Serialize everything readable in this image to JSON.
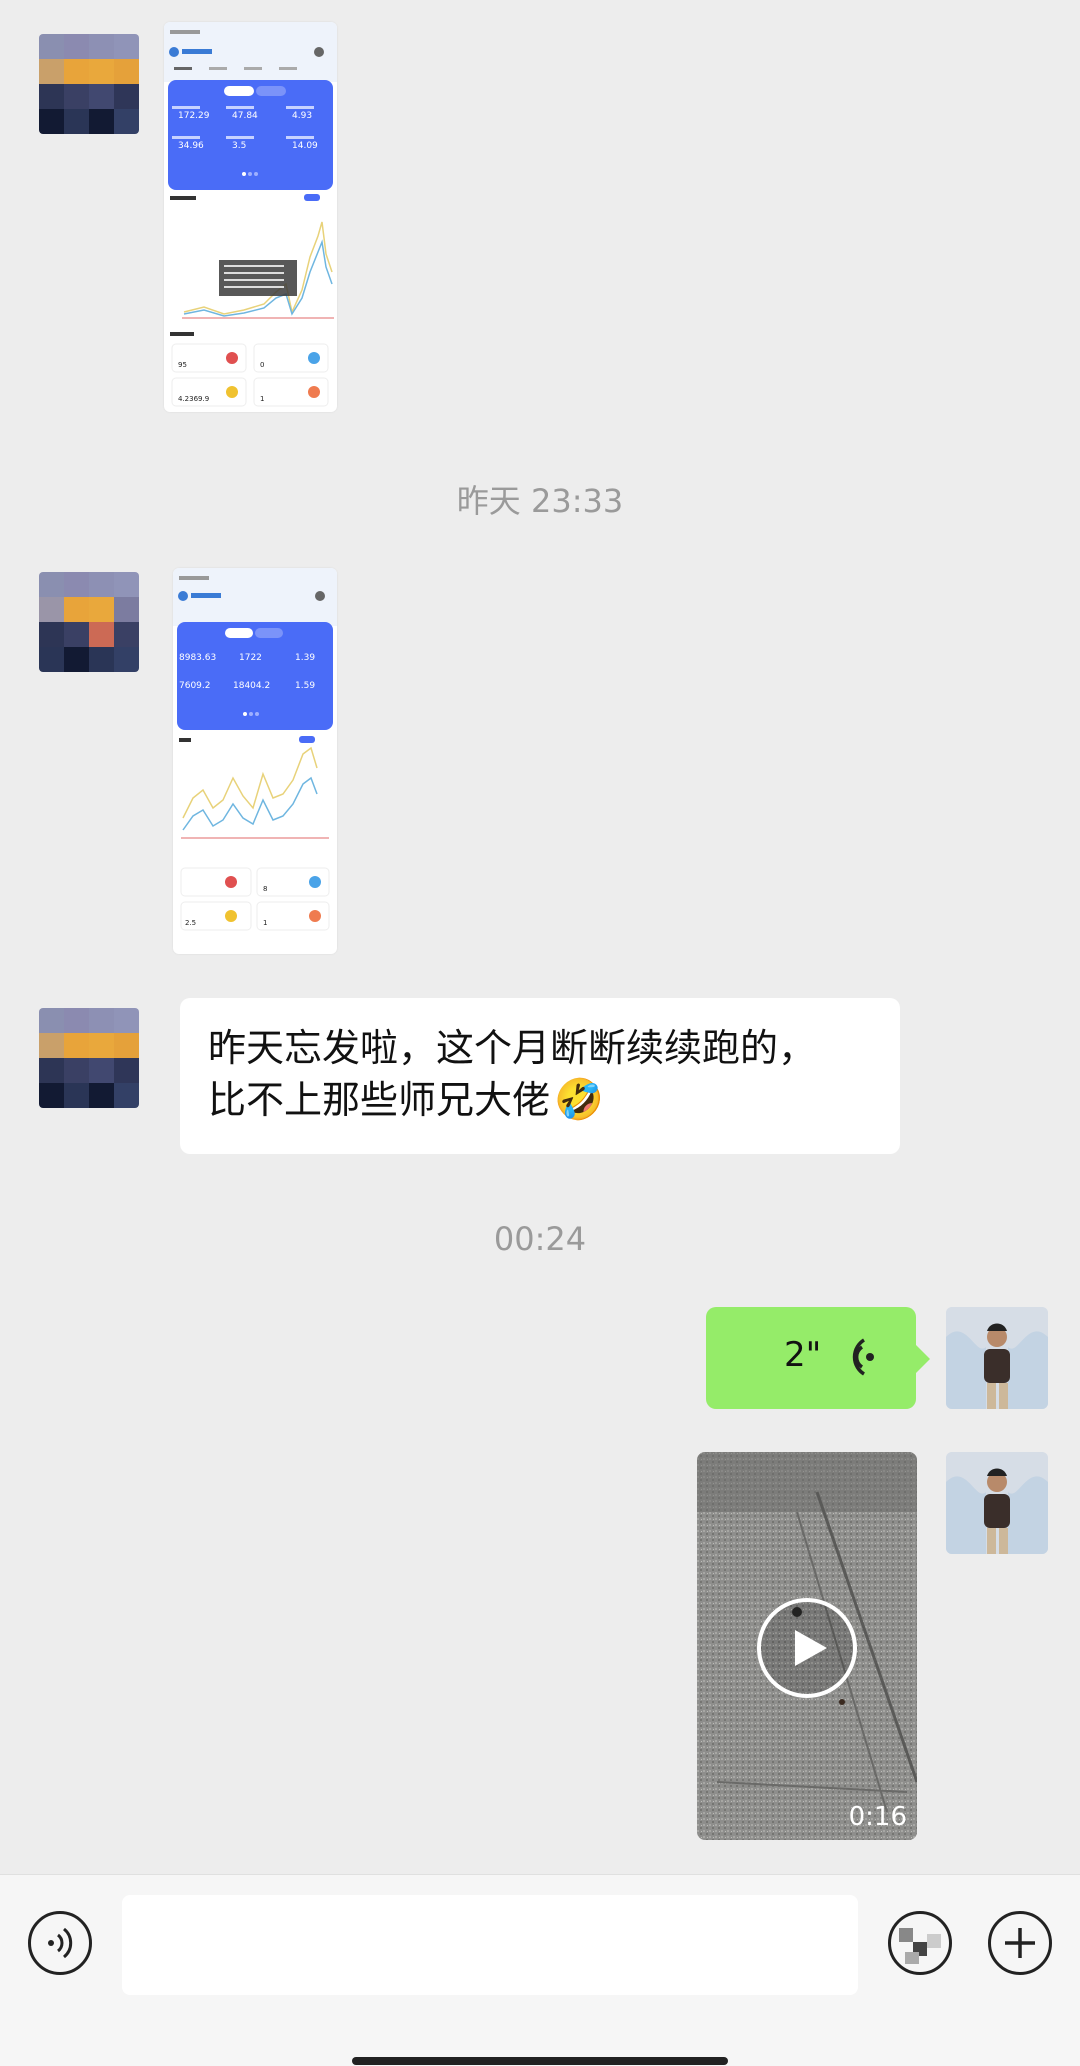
{
  "messages": {
    "timestamp_1": "昨天 23:33",
    "timestamp_2": "00:24",
    "text_message": {
      "line1": "昨天忘发啦，这个月断断续续跑的，",
      "line2": "比不上那些师兄大佬",
      "emoji": "🤣"
    },
    "voice_message": {
      "duration": "2\""
    },
    "video_message": {
      "duration": "0:16"
    }
  },
  "screenshot_1": {
    "stats_row1": [
      "172.29",
      "47.84",
      "4.93"
    ],
    "stats_row2": [
      "34.96",
      "3.5",
      "14.09"
    ],
    "cards": [
      "95",
      "0",
      "4.2369.9",
      "1"
    ]
  },
  "screenshot_2": {
    "stats_row1": [
      "8983.63",
      "1722",
      "1.39"
    ],
    "stats_row2": [
      "7609.2",
      "18404.2",
      "1.59"
    ],
    "cards": [
      "",
      "8",
      "2.5",
      "1"
    ]
  },
  "colors": {
    "background": "#ededed",
    "voice_bubble": "#95ec69",
    "text_bubble": "#ffffff",
    "accent_blue": "#4a6cf7"
  }
}
